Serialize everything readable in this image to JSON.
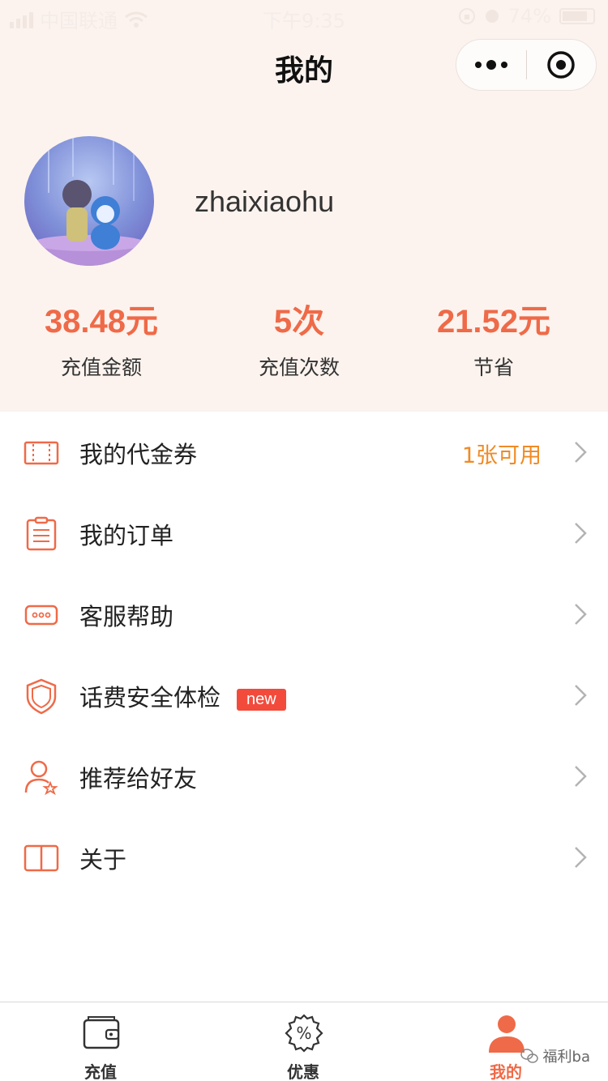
{
  "status_bar": {
    "carrier": "中国联通",
    "time": "下午9:35",
    "battery": "74%"
  },
  "nav": {
    "title": "我的"
  },
  "profile": {
    "username": "zhaixiaohu"
  },
  "stats": [
    {
      "value": "38.48元",
      "label": "充值金额"
    },
    {
      "value": "5次",
      "label": "充值次数"
    },
    {
      "value": "21.52元",
      "label": "节省"
    }
  ],
  "menu": [
    {
      "icon": "coupon-icon",
      "label": "我的代金券",
      "extra": "1张可用"
    },
    {
      "icon": "order-icon",
      "label": "我的订单"
    },
    {
      "icon": "customer-service-icon",
      "label": "客服帮助"
    },
    {
      "icon": "shield-icon",
      "label": "话费安全体检",
      "badge": "new"
    },
    {
      "icon": "user-star-icon",
      "label": "推荐给好友"
    },
    {
      "icon": "book-icon",
      "label": "关于"
    }
  ],
  "tabs": [
    {
      "icon": "wallet-icon",
      "label": "充值"
    },
    {
      "icon": "discount-icon",
      "label": "优惠"
    },
    {
      "icon": "user-icon",
      "label": "我的",
      "active": true
    }
  ],
  "watermark": "福利ba",
  "colors": {
    "accent": "#ef6a48",
    "header_bg": "#fcf3ee",
    "extra_text": "#f08a24",
    "badge_bg": "#f24b3c"
  }
}
